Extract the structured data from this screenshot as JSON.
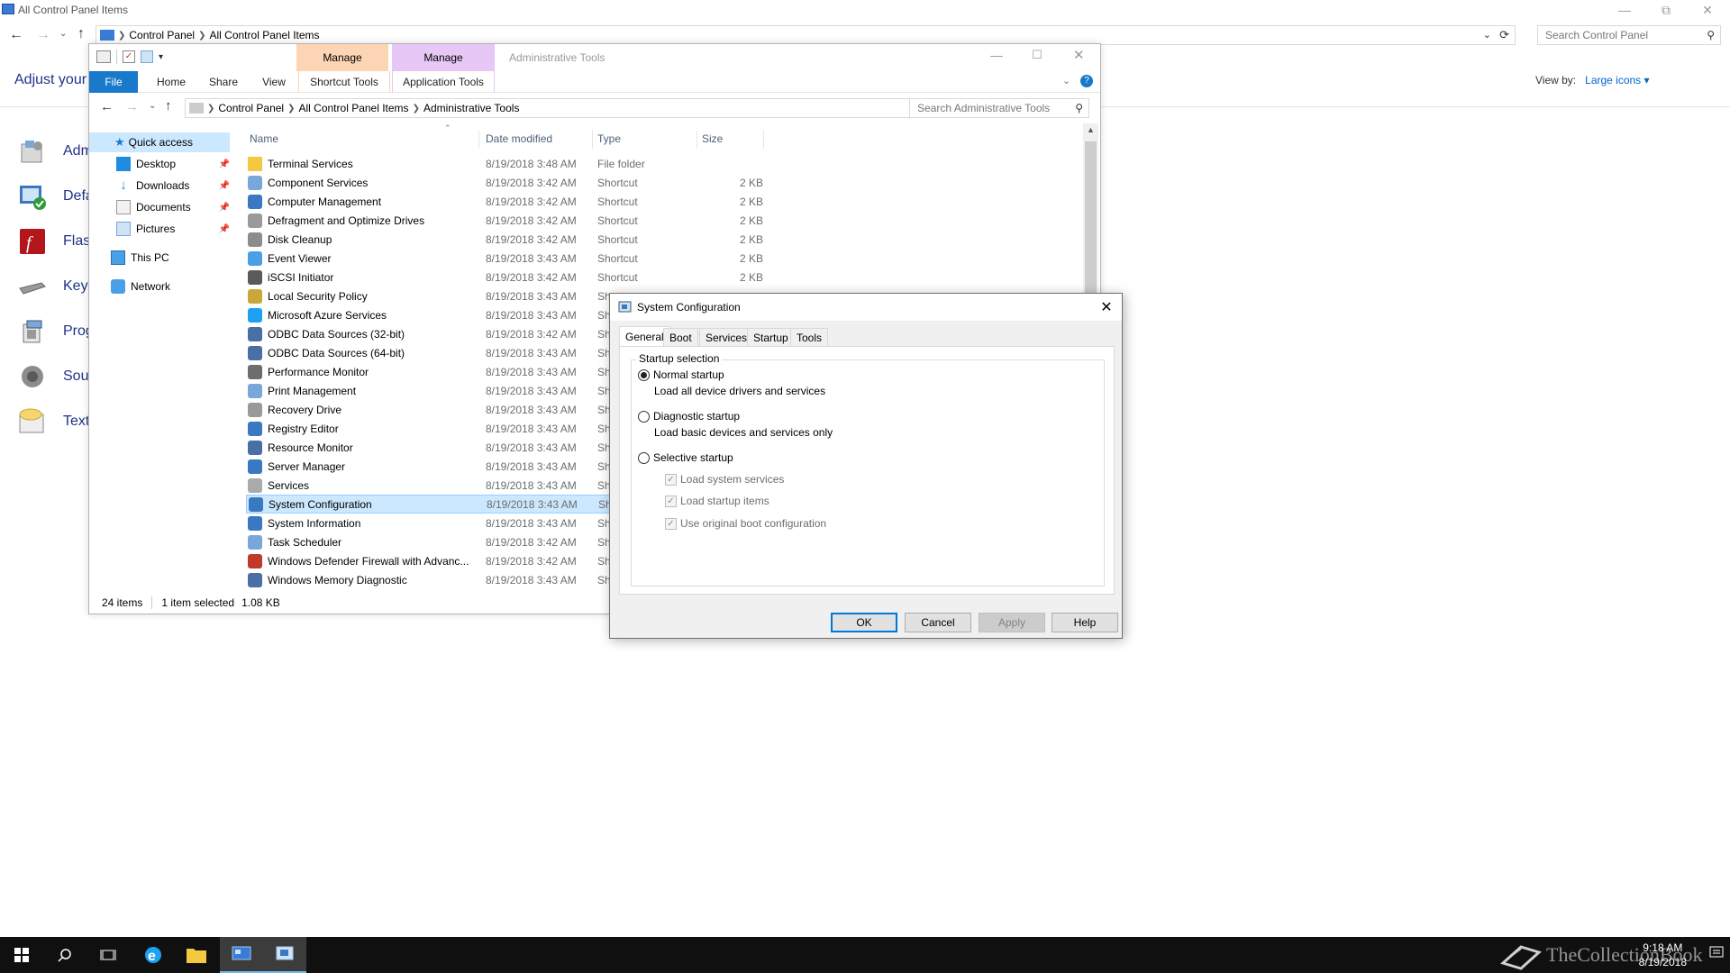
{
  "control_panel": {
    "window_title": "All Control Panel Items",
    "breadcrumb": [
      "Control Panel",
      "All Control Panel Items"
    ],
    "search_placeholder": "Search Control Panel",
    "heading": "Adjust your",
    "view_by_label": "View by:",
    "view_by_value": "Large icons",
    "items": [
      {
        "label": "Admi",
        "icon": "admin-tools-icon"
      },
      {
        "label": "Defau",
        "icon": "default-programs-icon"
      },
      {
        "label": "Flash",
        "icon": "flash-icon"
      },
      {
        "label": "Keybo",
        "icon": "keyboard-icon"
      },
      {
        "label": "Progr",
        "icon": "programs-icon"
      },
      {
        "label": "Soun",
        "icon": "sound-icon"
      },
      {
        "label": "Text t",
        "icon": "text-to-speech-icon"
      }
    ]
  },
  "explorer": {
    "ctx_tabs": [
      {
        "group": "Manage",
        "label": "Shortcut Tools",
        "color": "#fcd5b4"
      },
      {
        "group": "Manage",
        "label": "Application Tools",
        "color": "#e6c7f5"
      }
    ],
    "window_title": "Administrative Tools",
    "ribbon_tabs": [
      "File",
      "Home",
      "Share",
      "View"
    ],
    "breadcrumb": [
      "Control Panel",
      "All Control Panel Items",
      "Administrative Tools"
    ],
    "search_placeholder": "Search Administrative Tools",
    "nav": {
      "quick_access": "Quick access",
      "pinned": [
        "Desktop",
        "Downloads",
        "Documents",
        "Pictures"
      ],
      "this_pc": "This PC",
      "network": "Network"
    },
    "columns": {
      "name": "Name",
      "date": "Date modified",
      "type": "Type",
      "size": "Size"
    },
    "files": [
      {
        "name": "Terminal Services",
        "date": "8/19/2018 3:48 AM",
        "type": "File folder",
        "size": ""
      },
      {
        "name": "Component Services",
        "date": "8/19/2018 3:42 AM",
        "type": "Shortcut",
        "size": "2 KB"
      },
      {
        "name": "Computer Management",
        "date": "8/19/2018 3:42 AM",
        "type": "Shortcut",
        "size": "2 KB"
      },
      {
        "name": "Defragment and Optimize Drives",
        "date": "8/19/2018 3:42 AM",
        "type": "Shortcut",
        "size": "2 KB"
      },
      {
        "name": "Disk Cleanup",
        "date": "8/19/2018 3:42 AM",
        "type": "Shortcut",
        "size": "2 KB"
      },
      {
        "name": "Event Viewer",
        "date": "8/19/2018 3:43 AM",
        "type": "Shortcut",
        "size": "2 KB"
      },
      {
        "name": "iSCSI Initiator",
        "date": "8/19/2018 3:42 AM",
        "type": "Shortcut",
        "size": "2 KB"
      },
      {
        "name": "Local Security Policy",
        "date": "8/19/2018 3:43 AM",
        "type": "Sho",
        "size": ""
      },
      {
        "name": "Microsoft Azure Services",
        "date": "8/19/2018 3:43 AM",
        "type": "Sho",
        "size": ""
      },
      {
        "name": "ODBC Data Sources (32-bit)",
        "date": "8/19/2018 3:42 AM",
        "type": "Sho",
        "size": ""
      },
      {
        "name": "ODBC Data Sources (64-bit)",
        "date": "8/19/2018 3:43 AM",
        "type": "Sho",
        "size": ""
      },
      {
        "name": "Performance Monitor",
        "date": "8/19/2018 3:43 AM",
        "type": "Sho",
        "size": ""
      },
      {
        "name": "Print Management",
        "date": "8/19/2018 3:43 AM",
        "type": "Sho",
        "size": ""
      },
      {
        "name": "Recovery Drive",
        "date": "8/19/2018 3:43 AM",
        "type": "Sho",
        "size": ""
      },
      {
        "name": "Registry Editor",
        "date": "8/19/2018 3:43 AM",
        "type": "Sho",
        "size": ""
      },
      {
        "name": "Resource Monitor",
        "date": "8/19/2018 3:43 AM",
        "type": "Sho",
        "size": ""
      },
      {
        "name": "Server Manager",
        "date": "8/19/2018 3:43 AM",
        "type": "Sho",
        "size": ""
      },
      {
        "name": "Services",
        "date": "8/19/2018 3:43 AM",
        "type": "Sho",
        "size": ""
      },
      {
        "name": "System Configuration",
        "date": "8/19/2018 3:43 AM",
        "type": "Sho",
        "size": ""
      },
      {
        "name": "System Information",
        "date": "8/19/2018 3:43 AM",
        "type": "Sho",
        "size": ""
      },
      {
        "name": "Task Scheduler",
        "date": "8/19/2018 3:42 AM",
        "type": "Sho",
        "size": ""
      },
      {
        "name": "Windows Defender Firewall with Advanc...",
        "date": "8/19/2018 3:42 AM",
        "type": "Sho",
        "size": ""
      },
      {
        "name": "Windows Memory Diagnostic",
        "date": "8/19/2018 3:43 AM",
        "type": "Sho",
        "size": ""
      }
    ],
    "selected_file": "System Configuration",
    "status": {
      "count": "24 items",
      "selected": "1 item selected",
      "size": "1.08 KB"
    }
  },
  "dialog": {
    "title": "System Configuration",
    "tabs": [
      "General",
      "Boot",
      "Services",
      "Startup",
      "Tools"
    ],
    "active_tab": "General",
    "group_label": "Startup selection",
    "options": [
      {
        "label": "Normal startup",
        "desc": "Load all device drivers and services",
        "checked": true
      },
      {
        "label": "Diagnostic startup",
        "desc": "Load basic devices and services only",
        "checked": false
      },
      {
        "label": "Selective startup",
        "desc": "",
        "checked": false
      }
    ],
    "checkboxes": [
      "Load system services",
      "Load startup items",
      "Use original boot configuration"
    ],
    "buttons": {
      "ok": "OK",
      "cancel": "Cancel",
      "apply": "Apply",
      "help": "Help"
    }
  },
  "taskbar": {
    "time": "9:18 AM",
    "date": "8/19/2018",
    "watermark": "TheCollectionBook"
  },
  "colors": {
    "accent": "#0078d7",
    "selection": "#cce8ff",
    "link": "#1e3287",
    "taskbar": "#101010"
  }
}
